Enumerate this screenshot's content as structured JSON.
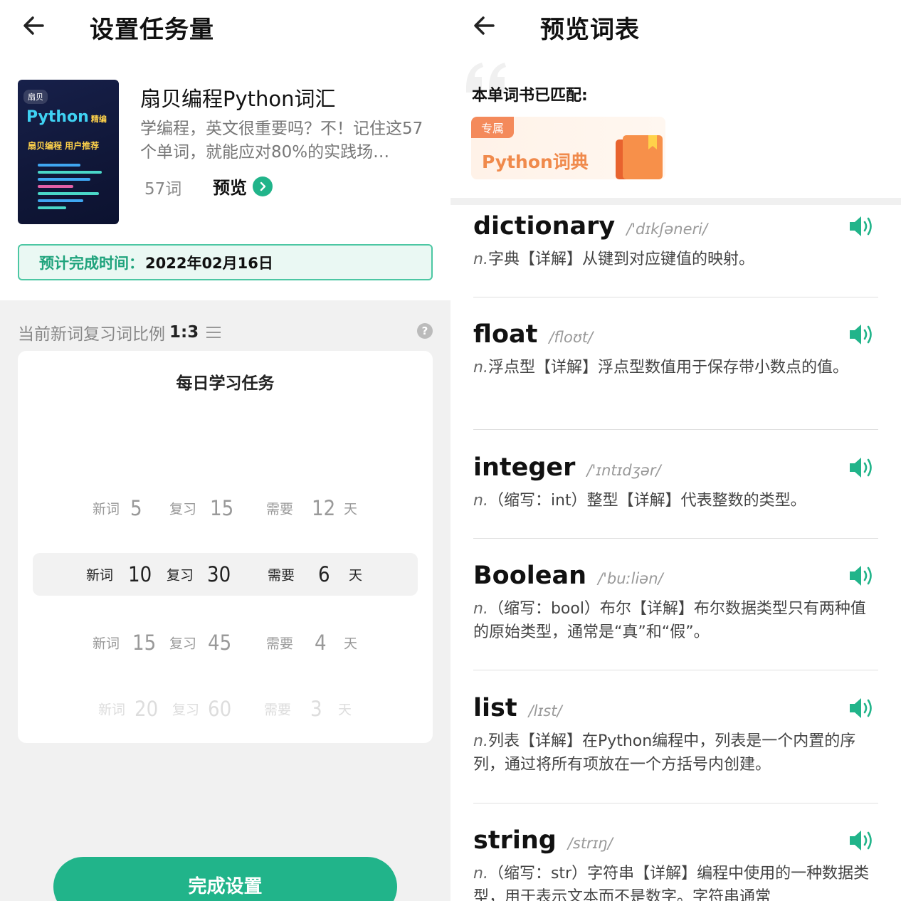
{
  "left": {
    "title": "设置任务量",
    "book": {
      "cover_brand": "扇贝",
      "cover_py": "Python",
      "cover_py_tag": "精编",
      "cover_tag": "扇贝编程 用户推荐",
      "title": "扇贝编程Python词汇",
      "desc": "学编程，英文很重要吗？不！记住这57个单词，就能应对80%的实践场…",
      "count": "57词",
      "preview_label": "预览"
    },
    "eta": {
      "label": "预计完成时间：",
      "value": "2022年02月16日"
    },
    "ratio": {
      "label": "当前新词复习词比例",
      "value": "1:3"
    },
    "task": {
      "title": "每日学习任务",
      "options": [
        {
          "new_label": "新词",
          "new": "5",
          "review_label": "复习",
          "review": "15",
          "need_label": "需要",
          "days": "12",
          "unit": "天"
        },
        {
          "new_label": "新词",
          "new": "10",
          "review_label": "复习",
          "review": "30",
          "need_label": "需要",
          "days": "6",
          "unit": "天"
        },
        {
          "new_label": "新词",
          "new": "15",
          "review_label": "复习",
          "review": "45",
          "need_label": "需要",
          "days": "4",
          "unit": "天"
        },
        {
          "new_label": "新词",
          "new": "20",
          "review_label": "复习",
          "review": "60",
          "need_label": "需要",
          "days": "3",
          "unit": "天"
        }
      ]
    },
    "finish_label": "完成设置"
  },
  "right": {
    "title": "预览词表",
    "matched": "本单词书已匹配:",
    "dict": {
      "badge": "专属",
      "name": "Python词典"
    },
    "words": [
      {
        "word": "dictionary",
        "phonetic": "/'dɪkʃəneri/",
        "pos": "n.",
        "def": "字典【详解】从键到对应键值的映射。"
      },
      {
        "word": "float",
        "phonetic": "/floʊt/",
        "pos": "n.",
        "def": "浮点型【详解】浮点型数值用于保存带小数点的值。"
      },
      {
        "word": "integer",
        "phonetic": "/'ɪntɪdʒər/",
        "pos": "n.",
        "def": "（缩写：int）整型【详解】代表整数的类型。"
      },
      {
        "word": "Boolean",
        "phonetic": "/'buːliən/",
        "pos": "n.",
        "def": "（缩写：bool）布尔【详解】布尔数据类型只有两种值的原始类型，通常是“真”和“假”。"
      },
      {
        "word": "list",
        "phonetic": "/lɪst/",
        "pos": "n.",
        "def": "列表【详解】在Python编程中，列表是一个内置的序列，通过将所有项放在一个方括号内创建。"
      },
      {
        "word": "string",
        "phonetic": "/strɪŋ/",
        "pos": "n.",
        "def": "（缩写：str）字符串【详解】编程中使用的一种数据类型，用于表示文本而不是数字。字符串通常"
      }
    ]
  },
  "colors": {
    "accent": "#21b48a",
    "dict_orange": "#f08a4c"
  }
}
